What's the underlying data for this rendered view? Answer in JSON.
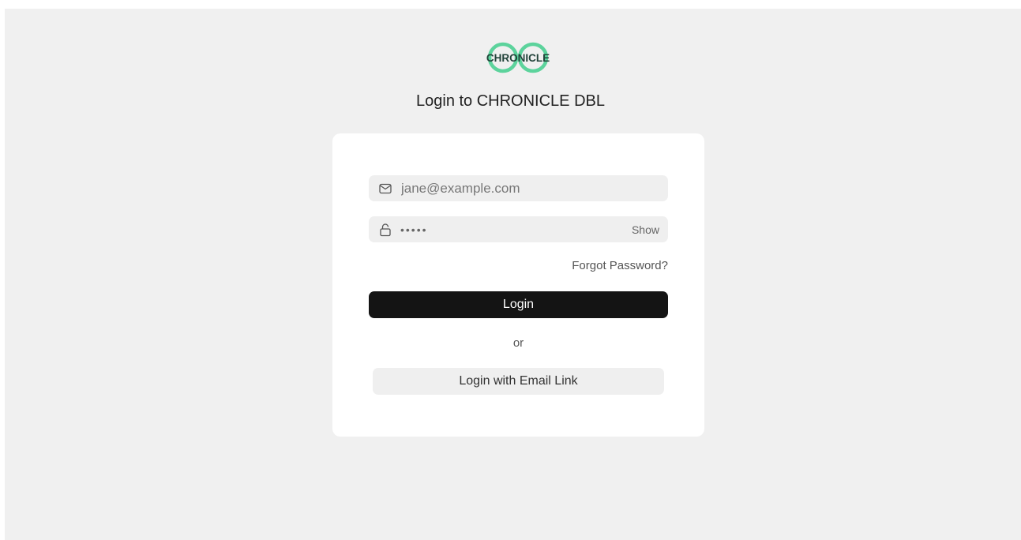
{
  "brand": {
    "logo_text": "CHRONICLE",
    "accent_color": "#5cd39c",
    "logo_icon": "infinity-rings-logo"
  },
  "page": {
    "title": "Login to CHRONICLE DBL"
  },
  "form": {
    "email": {
      "icon": "envelope-icon",
      "placeholder": "jane@example.com",
      "value": ""
    },
    "password": {
      "icon": "lock-icon",
      "masked_value": "•••••",
      "toggle_label": "Show"
    },
    "forgot_password": "Forgot Password?",
    "login_label": "Login",
    "separator": "or",
    "email_link_label": "Login with Email Link"
  }
}
